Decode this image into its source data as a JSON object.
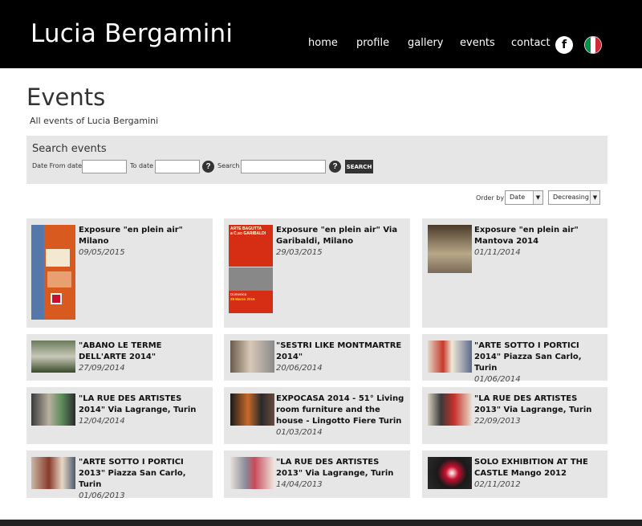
{
  "header": {
    "site_title": "Lucia Bergamini",
    "nav": [
      {
        "label": "home"
      },
      {
        "label": "profile"
      },
      {
        "label": "gallery"
      },
      {
        "label": "events"
      },
      {
        "label": "contact"
      }
    ],
    "facebook_glyph": "f",
    "facebook_icon": "facebook-icon",
    "flag_icon": "italy-flag-icon",
    "flag_colors": [
      "#009246",
      "#ffffff",
      "#ce2b37"
    ]
  },
  "page": {
    "title": "Events",
    "subtitle": "All events of Lucia Bergamini"
  },
  "search": {
    "title": "Search events",
    "date_from_label": "Date From date",
    "to_date_label": "To date",
    "search_label": "Search",
    "date_from_value": "",
    "to_date_value": "",
    "search_value": "",
    "help_glyph": "?",
    "button_label": "SEARCH"
  },
  "order": {
    "label": "Order by",
    "field": "Date",
    "direction": "Decreasing",
    "arrow": "▼"
  },
  "events": [
    {
      "title": "Exposure \"en plein air\" Milano",
      "date": "09/05/2015"
    },
    {
      "title": "Exposure \"en plein air\" Via Garibaldi, Milano",
      "date": "29/03/2015"
    },
    {
      "title": "Exposure \"en plein air\" Mantova 2014",
      "date": "01/11/2014"
    },
    {
      "title": "\"ABANO LE TERME DELL'ARTE 2014\"",
      "date": "27/09/2014"
    },
    {
      "title": "\"SESTRI LIKE MONTMARTRE 2014\"",
      "date": "20/06/2014"
    },
    {
      "title": "\"ARTE SOTTO I PORTICI 2014\" Piazza San Carlo, Turin",
      "date": "01/06/2014"
    },
    {
      "title": "\"LA RUE DES ARTISTES 2014\" Via Lagrange, Turin",
      "date": "12/04/2014"
    },
    {
      "title": "EXPOCASA 2014 - 51° Living room furniture and the house - Lingotto Fiere Turin",
      "date": "01/03/2014"
    },
    {
      "title": "\"LA RUE DES ARTISTES 2013\" Via Lagrange, Turin",
      "date": "22/09/2013"
    },
    {
      "title": "\"ARTE SOTTO I PORTICI 2013\" Piazza San Carlo, Turin",
      "date": "01/06/2013"
    },
    {
      "title": "\"LA RUE DES ARTISTES 2013\" Via Lagrange, Turin",
      "date": "14/04/2013"
    },
    {
      "title": "SOLO EXHIBITION AT THE CASTLE Mango 2012",
      "date": "02/11/2012"
    }
  ],
  "poster": {
    "line1": "ARTE BAGUTTA",
    "line2": "a C.so GARIBALDI",
    "line3": "Domenica",
    "line4": "29 Marzo 2015"
  }
}
